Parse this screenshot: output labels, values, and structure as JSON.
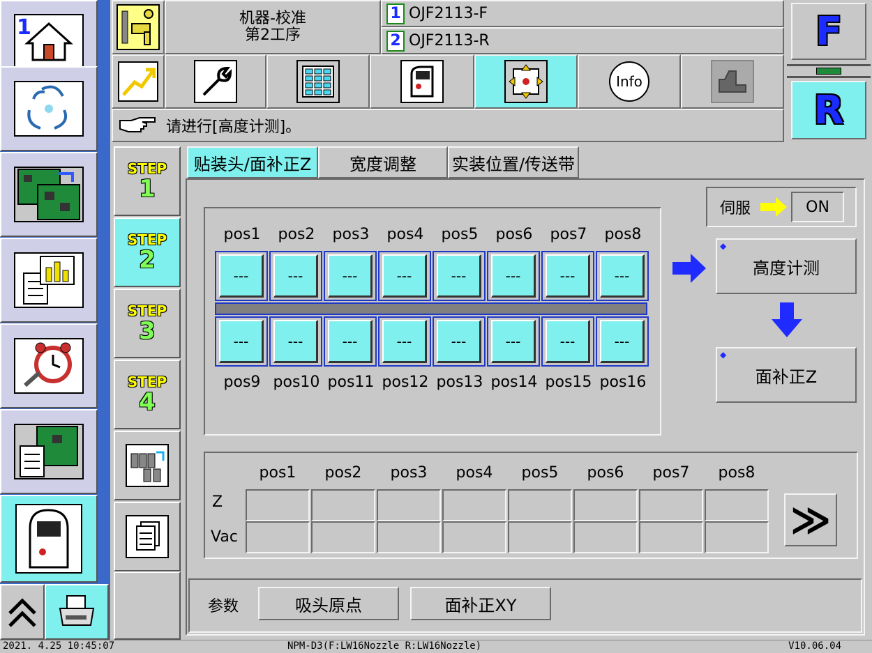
{
  "header": {
    "title_line1": "机器-校准",
    "title_line2": "第2工序",
    "program_1_num": "1",
    "program_1": "OJF2113-F",
    "program_2_num": "2",
    "program_2": "OJF2113-R",
    "head_f": "F",
    "head_r": "R"
  },
  "toolbar": {
    "info_label": "Info"
  },
  "message": "请进行[高度计测]。",
  "steps": [
    {
      "label": "STEP",
      "num": "1"
    },
    {
      "label": "STEP",
      "num": "2"
    },
    {
      "label": "STEP",
      "num": "3"
    },
    {
      "label": "STEP",
      "num": "4"
    }
  ],
  "subtabs": [
    "贴装头/面补正Z",
    "宽度调整",
    "实装位置/传送带"
  ],
  "servo": {
    "label": "伺服",
    "value": "ON"
  },
  "positions_top": [
    "pos1",
    "pos2",
    "pos3",
    "pos4",
    "pos5",
    "pos6",
    "pos7",
    "pos8"
  ],
  "positions_bottom": [
    "pos9",
    "pos10",
    "pos11",
    "pos12",
    "pos13",
    "pos14",
    "pos15",
    "pos16"
  ],
  "slot_value": "---",
  "actions": {
    "height_measure": "高度计测",
    "surface_z": "面补正Z"
  },
  "table": {
    "columns": [
      "pos1",
      "pos2",
      "pos3",
      "pos4",
      "pos5",
      "pos6",
      "pos7",
      "pos8"
    ],
    "rows": [
      "Z",
      "Vac"
    ],
    "next_label": "≫"
  },
  "params": {
    "label": "参数",
    "nozzle_origin": "吸头原点",
    "surface_xy": "面补正XY"
  },
  "status": {
    "datetime": "2021. 4.25 10:45:07",
    "machine": "NPM-D3(F:LW16Nozzle R:LW16Nozzle)",
    "version": "V10.06.04"
  },
  "sidebar": {
    "home_num": "1"
  },
  "colors": {
    "cyan": "#7ff0ee",
    "blue_arrow": "#1f2bff",
    "sidebar_blue": "#3a69c9"
  }
}
